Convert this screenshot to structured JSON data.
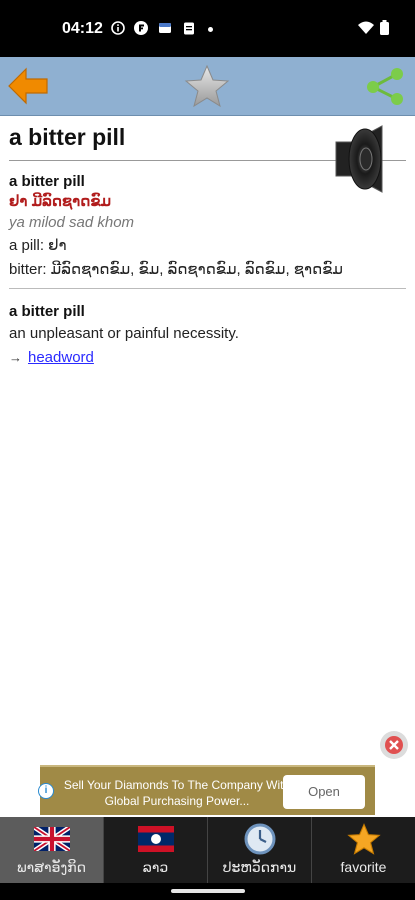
{
  "status": {
    "time": "04:12"
  },
  "toolbar": {
    "back_icon": "back-arrow-icon",
    "favorite_icon": "star-icon",
    "share_icon": "share-icon"
  },
  "entry": {
    "title": "a bitter pill",
    "block1": {
      "headword": "a bitter pill",
      "lao": "ຢາ ມີລົດຊາດຂົມ",
      "roman": "ya milod sad khom",
      "line1": "a pill: ຢາ",
      "line2": "bitter: ມີລົດຊາດຂົມ, ຂົມ, ລົດຊາດຂົມ, ລົດຂົມ, ຊາດຂົມ"
    },
    "block2": {
      "headword": "a bitter pill",
      "definition": "an unpleasant or painful necessity.",
      "arrow": "→",
      "link": "headword"
    }
  },
  "ad": {
    "text": "Sell Your Diamonds To The Company With Global Purchasing Power...",
    "button": "Open",
    "info": "i"
  },
  "tabs": [
    {
      "label": "ພາສາອັງກິດ",
      "icon": "uk-flag-icon"
    },
    {
      "label": "ລາວ",
      "icon": "laos-flag-icon"
    },
    {
      "label": "ປະຫວັດການ",
      "icon": "clock-icon"
    },
    {
      "label": "favorite",
      "icon": "star-icon"
    }
  ],
  "colors": {
    "toolbar": "#8fb0d1",
    "lao_text": "#b11c1c",
    "link": "#2a2aff",
    "ad_bg": "#a08a46"
  }
}
